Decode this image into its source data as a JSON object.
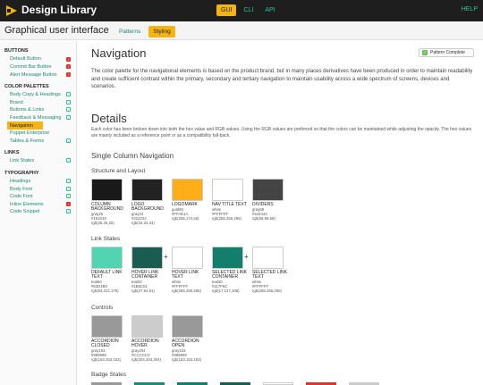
{
  "topbar": {
    "brand": "Design Library",
    "tabs": [
      {
        "label": "GUI",
        "active": true
      },
      {
        "label": "CLI",
        "active": false
      },
      {
        "label": "API",
        "active": false
      }
    ],
    "help": "HELP"
  },
  "subbar": {
    "title": "Graphical user interface",
    "tabs": [
      {
        "label": "Patterns",
        "active": false
      },
      {
        "label": "Styling",
        "active": true
      }
    ]
  },
  "sidebar": {
    "groups": [
      {
        "heading": "BUTTONS",
        "items": [
          {
            "label": "Default Button",
            "badge": "red"
          },
          {
            "label": "Commit Bar Button",
            "badge": "red"
          },
          {
            "label": "Alert Message Button",
            "badge": "red"
          }
        ]
      },
      {
        "heading": "COLOR PALETTES",
        "items": [
          {
            "label": "Body Copy & Headings",
            "badge": "green"
          },
          {
            "label": "Brand",
            "badge": "green"
          },
          {
            "label": "Buttons & Links",
            "badge": "green"
          },
          {
            "label": "Feedback & Messaging",
            "badge": "green"
          },
          {
            "label": "Navigation",
            "badge": "",
            "active": true
          },
          {
            "label": "Puppet Enterprise",
            "badge": ""
          },
          {
            "label": "Tables & Forms",
            "badge": "green"
          }
        ]
      },
      {
        "heading": "LINKS",
        "items": [
          {
            "label": "Link States",
            "badge": "green"
          }
        ]
      },
      {
        "heading": "TYPOGRAPHY",
        "items": [
          {
            "label": "Headings",
            "badge": "green"
          },
          {
            "label": "Body Font",
            "badge": "green"
          },
          {
            "label": "Code Font",
            "badge": "green"
          },
          {
            "label": "Inline Elements",
            "badge": "red"
          },
          {
            "label": "Code Snippet",
            "badge": "green"
          }
        ]
      }
    ]
  },
  "main": {
    "title": "Navigation",
    "status": "Pattern Complete",
    "intro": "The color palette for the navigational elements is based on the product brand, but in many places derivatives have been produced in order to maintain readability and create sufficient contrast within the primary, secondary and tertiary navigation to maintain usability across a wide spectrum of screens, devices and scenarios.",
    "details_title": "Details",
    "details_text": "Each color has been broken down into both the hex value and RGB values. Using the RGB values are preferred so that the colors can be maintained while adjusting the opacity. The hex values are mainly included as a reference point or as a compatibility fall-back.",
    "section_title": "Single Column Navigation",
    "groups": [
      {
        "title": "Structure and Layout",
        "swatches": [
          {
            "name": "COLUMN BACKGROUND",
            "var": "gray25",
            "hex": "#191919",
            "rgb": "rgb(25,25,25)",
            "color": "#191919"
          },
          {
            "name": "LOGO BACKGROUND",
            "var": "gray34",
            "hex": "#222222",
            "rgb": "rgb(34,34,34)",
            "color": "#222222"
          },
          {
            "name": "LOGOMARK",
            "var": "gold50",
            "hex": "#FFAE1A",
            "rgb": "rgb(255,174,26)",
            "color": "#FFAE1A"
          },
          {
            "name": "NAV TITLE TEXT",
            "var": "white",
            "hex": "#FFFFFF",
            "rgb": "rgb(255,255,255)",
            "color": "#FFFFFF"
          },
          {
            "name": "DIVIDERS",
            "var": "gray68",
            "hex": "#444444",
            "rgb": "rgb(68,68,68)",
            "color": "#444444"
          }
        ]
      },
      {
        "title": "Link States",
        "swatches": [
          {
            "name": "DEFAULT LINK TEXT",
            "var": "teal60",
            "hex": "#53D4B0",
            "rgb": "rgb(83,212,176)",
            "color": "#53D4B0"
          },
          {
            "name": "HOVER LINK CONTAINER",
            "var": "teal20",
            "hex": "#1B5C51",
            "rgb": "rgb(27,92,81)",
            "color": "#1B5C51"
          },
          {
            "name": "HOVER LINK TEXT",
            "var": "white",
            "hex": "#FFFFFF",
            "rgb": "rgb(255,255,255)",
            "color": "#FFFFFF",
            "plus": true
          },
          {
            "name": "SELECTED LINK CONTAINER",
            "var": "teal30",
            "hex": "#117F6C",
            "rgb": "rgb(17,127,108)",
            "color": "#117F6C"
          },
          {
            "name": "SELECTED LINK TEXT",
            "var": "white",
            "hex": "#FFFFFF",
            "rgb": "rgb(255,255,255)",
            "color": "#FFFFFF",
            "plus": true
          }
        ]
      },
      {
        "title": "Controls",
        "swatches": [
          {
            "name": "ACCORDION CLOSED",
            "var": "gray153",
            "hex": "#999999",
            "rgb": "rgb(153,153,153)",
            "color": "#999999"
          },
          {
            "name": "ACCORDION HOVER",
            "var": "gray204",
            "hex": "#CCCCCC",
            "rgb": "rgb(204,204,204)",
            "color": "#CCCCCC"
          },
          {
            "name": "ACCORDION OPEN",
            "var": "gray153",
            "hex": "#999999",
            "rgb": "rgb(153,153,153)",
            "color": "#999999"
          }
        ]
      }
    ],
    "badge_title": "Badge States",
    "badge_colors": [
      "#999999",
      "#1B8A72",
      "#117F6C",
      "#1B5C51",
      "#FFFFFF",
      "#E0322F",
      "#CCCCCC"
    ]
  }
}
